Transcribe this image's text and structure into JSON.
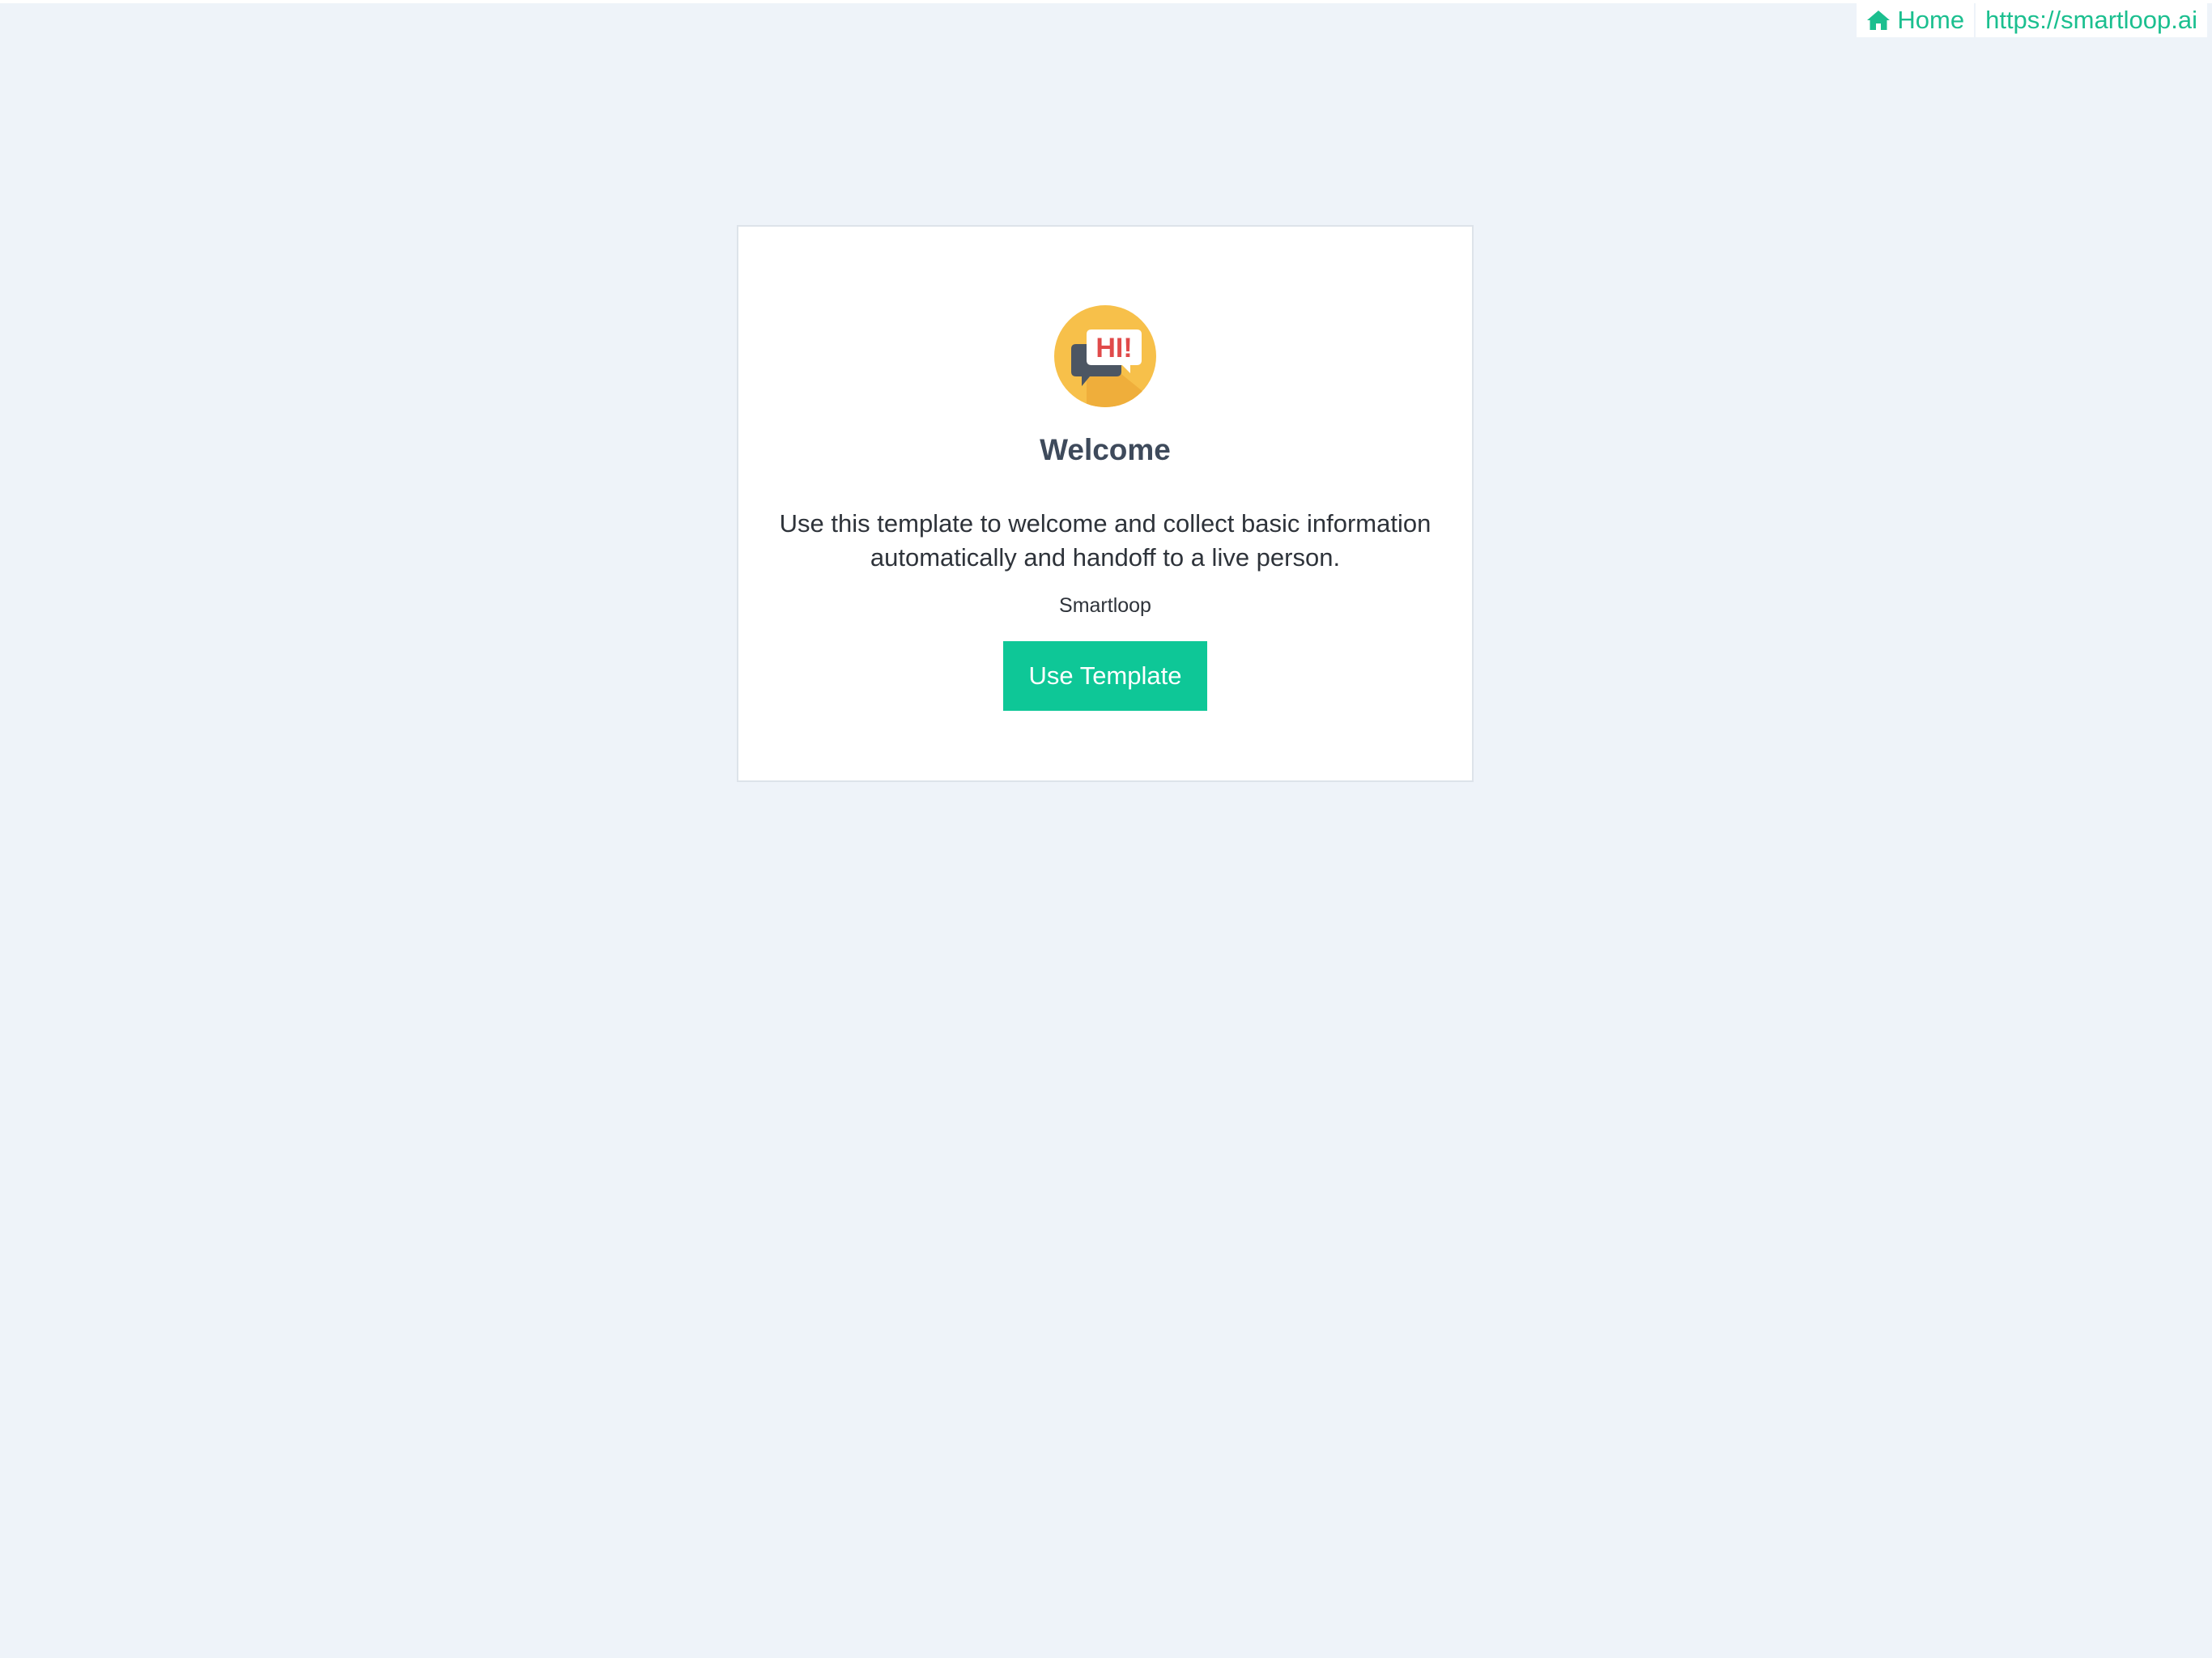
{
  "nav": {
    "home_label": "Home",
    "home_icon": "home-icon",
    "site_link_label": "https://smartloop.ai"
  },
  "card": {
    "logo_icon": "hi-speech-bubble-logo",
    "logo_text": "HI!",
    "title": "Welcome",
    "description": "Use this template to welcome and collect basic information automatically and handoff to a live person.",
    "author": "Smartloop",
    "button_label": "Use Template"
  },
  "colors": {
    "accent": "#0ec797",
    "link": "#1bbf8f",
    "background": "#eef3f9",
    "logo_circle": "#f7c04a",
    "logo_text": "#e04a4a"
  }
}
